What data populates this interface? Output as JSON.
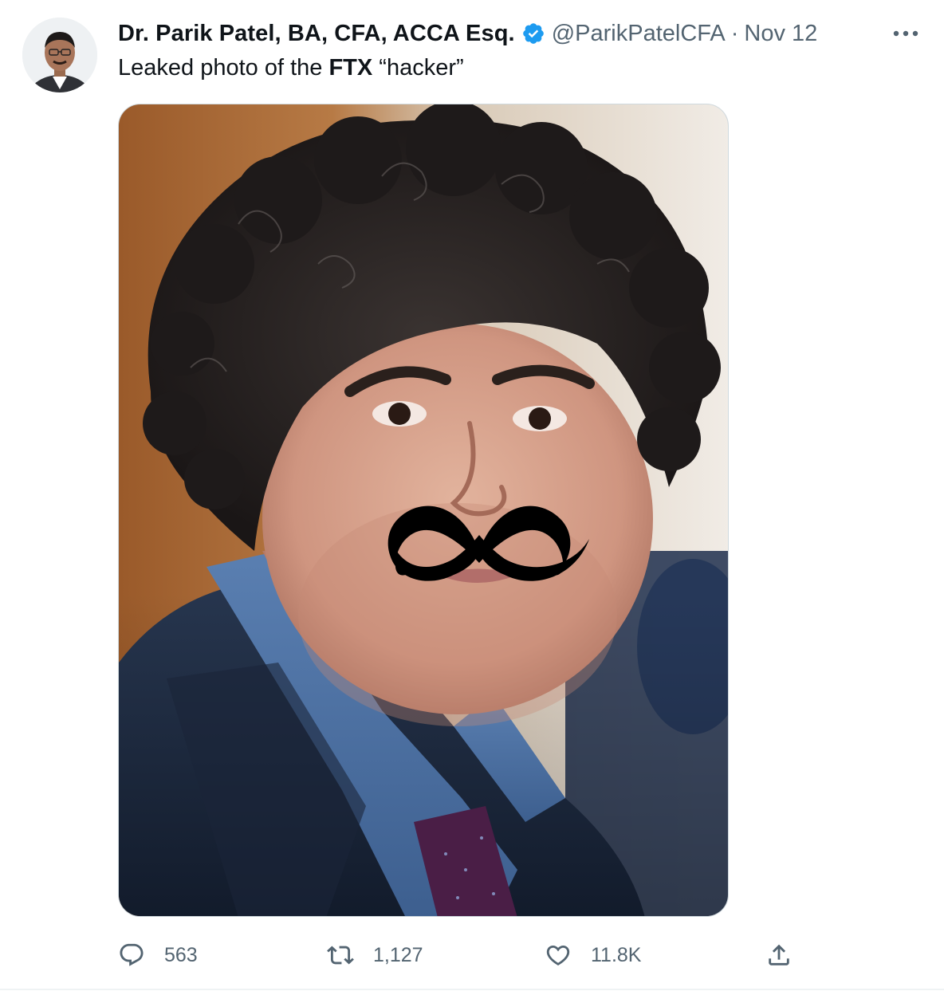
{
  "tweet": {
    "author": {
      "display_name": "Dr. Parik Patel, BA, CFA, ACCA Esq.",
      "handle": "@ParikPatelCFA",
      "verified": true,
      "avatar_icon": "profile-photo"
    },
    "separator": "·",
    "date": "Nov 12",
    "text": {
      "part1": "Leaked photo of the ",
      "bold": "FTX",
      "part2": " “hacker”"
    },
    "media": {
      "type": "photo",
      "icon": "photo-man-with-mustache"
    },
    "actions": {
      "reply": {
        "icon": "reply-icon",
        "count": "563"
      },
      "retweet": {
        "icon": "retweet-icon",
        "count": "1,127"
      },
      "like": {
        "icon": "heart-icon",
        "count": "11.8K"
      },
      "share": {
        "icon": "share-icon"
      }
    },
    "more_icon": "more-icon"
  },
  "colors": {
    "text": "#0f1419",
    "secondary": "#536471",
    "verified": "#1d9bf0",
    "border": "#cfd9de"
  }
}
